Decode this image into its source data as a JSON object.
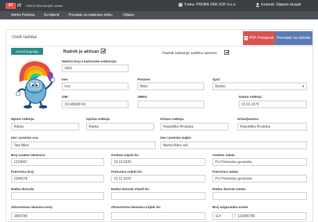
{
  "app": {
    "logo": "ST",
    "brand_suffix": "IT",
    "subtitle": "Online informacijski sustav",
    "firm": "Tvrtka: PROBA ZNR ZOP d.o.o.",
    "user": "Korisnik: Stjepan Huzjak"
  },
  "nav": [
    "Admin Početna",
    "Svi klijenti",
    "Povratak na odabranu tvrtku",
    "Odjava"
  ],
  "header": {
    "title": "Uredi radnika",
    "pdf_button": "PDF Primjerak",
    "back_button": "Povratak na radnike"
  },
  "photo": {
    "button": "Uredi fotografiju"
  },
  "status": {
    "active_label": "Radnik je aktivan",
    "active": true,
    "protective_label": "Radnik zadužuje zaštitnu opremu",
    "protective": true
  },
  "fields": {
    "maticni_label": "Matični broj iz kadrovske evidencije:",
    "maticni": "0001",
    "ime_label": "Ime:",
    "ime": "Ivor",
    "prezime_label": "Prezime:",
    "prezime": "Bilen",
    "spol_label": "Spol:",
    "spol": "Muško",
    "oib_label": "OIB:",
    "oib": "32145698741",
    "jmbg_label": "JMBG:",
    "jmbg": "",
    "datum_label": "Datum rođenja:",
    "datum": "01.01.1970",
    "mjesto_label": "Mjesto rođenja:",
    "mjesto": "Rijeka",
    "opcina_label": "Općina rođenja:",
    "opcina": "Rijeka",
    "drzava_label": "Država rođenja:",
    "drzava": "Republika Hrvatska",
    "drzavljanstvo_label": "Državljanstvo:",
    "drzavljanstvo": "Republika Hrvatska",
    "otac_label": "Ime i prezime oca:",
    "otac": "Tata Bilen",
    "majka_label": "Ime i prezime majke:",
    "majka": "Mama Bilen rođ.",
    "osobna_broj_label": "Broj osobne iskaznice:",
    "osobna_broj": "1234567",
    "osobna_vrijedi_label": "Osobna vrijedi do:",
    "osobna_vrijedi": "10.10.2020",
    "osobna_izdala_label": "Osobnu izdala:",
    "osobna_izdala": "PU Primorsko goranska",
    "putovnica_broj_label": "Putovnica broj:",
    "putovnica_broj": "2345678",
    "putovnica_vrijedi_label": "Putovnica vrijedi do:",
    "putovnica_vrijedi": "10.11.2020",
    "putovnica_izdala_label": "Putovnicu izdala:",
    "putovnica_izdala": "PU Primorsko goranska",
    "radna_label": "Radna dozvola:",
    "radna": "",
    "radna_vrijedi_label": "Radna dozvola vrijedi do:",
    "radna_vrijedi": "",
    "radna_izdala_label": "Radnu dozvolu izdala:",
    "radna_izdala": "",
    "zdravstvena_broj_label": "Zdravstvena iskaznica broj:",
    "zdravstvena_broj": "3456789",
    "zdravstvena_vrijedi_label": "Zdravstvena iskaznica vrijedi do:",
    "zdravstvena_vrijedi": "",
    "osiguranik_label": "Broj osiguranika osobe",
    "osiguranik_prefix": "114",
    "osiguranik": "123456789"
  },
  "colors": {
    "topbar": "#3a3f44",
    "navbar": "#4a5056",
    "danger": "#d9534f",
    "primary": "#5a7cb6",
    "teal": "#2a8b8b"
  }
}
